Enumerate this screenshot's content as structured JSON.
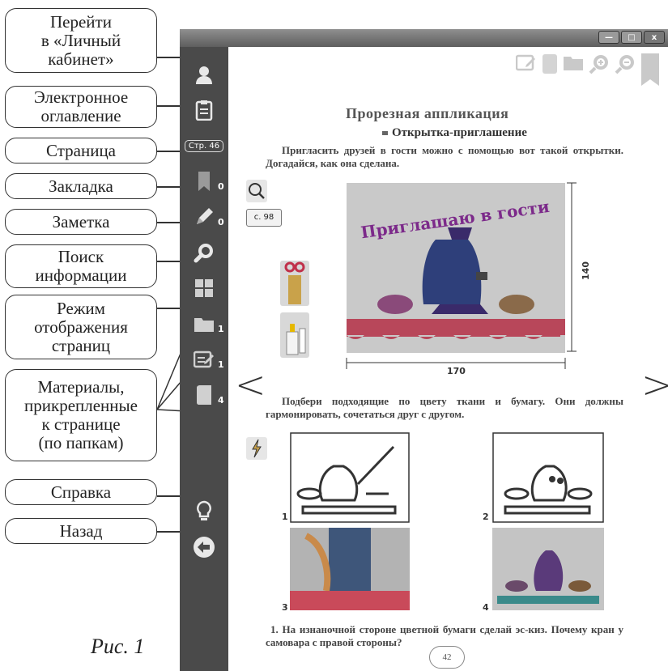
{
  "callouts": [
    {
      "name": "callout-personal-cabinet",
      "text": "Перейти\nв «Личный\nкабинет»"
    },
    {
      "name": "callout-table-of-contents",
      "text": "Электронное\nоглавление"
    },
    {
      "name": "callout-page",
      "text": "Страница"
    },
    {
      "name": "callout-bookmark",
      "text": "Закладка"
    },
    {
      "name": "callout-note",
      "text": "Заметка"
    },
    {
      "name": "callout-search",
      "text": "Поиск\nинформации"
    },
    {
      "name": "callout-display-mode",
      "text": "Режим\nотображения\nстраниц"
    },
    {
      "name": "callout-materials",
      "text": "Материалы,\nприкрепленные\nк странице\n(по папкам)"
    },
    {
      "name": "callout-help",
      "text": "Справка"
    },
    {
      "name": "callout-back",
      "text": "Назад"
    }
  ],
  "caption": "Рис. 1",
  "window": {
    "minimize": "—",
    "maximize": "□",
    "close": "x"
  },
  "sidebar": {
    "page_label": "Стр. 46",
    "bookmark_count": "0",
    "note_count": "0",
    "folder_count": "1",
    "edit_count": "1",
    "book_count": "4"
  },
  "content": {
    "title": "Прорезная аппликация",
    "subtitle": "Открытка-приглашение",
    "para1": "Пригласить друзей в гости можно с помощью вот такой открытки. Догадайся, как она сделана.",
    "page_ref": "с. 98",
    "card_text": "Приглашаю в гости",
    "dim_height": "140",
    "dim_width": "170",
    "para2": "Подбери подходящие по цвету ткани и бумагу. Они должны гармонировать, сочетаться друг с другом.",
    "step_labels": [
      "1",
      "2",
      "3",
      "4"
    ],
    "question": "1. На изнаночной стороне цветной бумаги сделай эс-киз. Почему кран у самовара с правой стороны?",
    "page_number": "42",
    "prev_arrow": "<",
    "next_arrow": ">"
  }
}
